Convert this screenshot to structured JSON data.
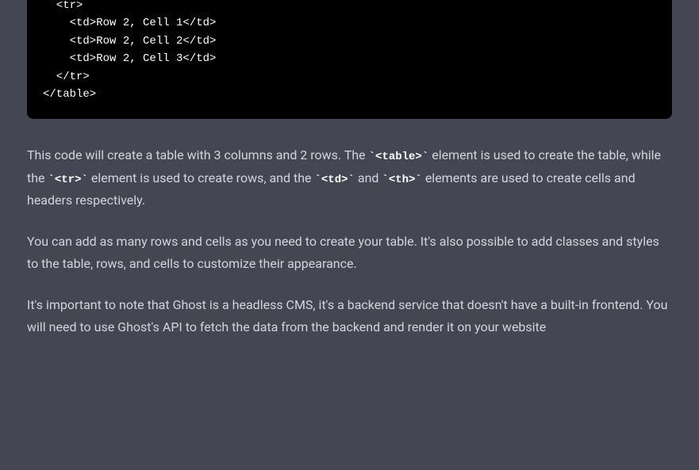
{
  "code": {
    "lines": [
      "  <tr>",
      "    <td>Row 2, Cell 1</td>",
      "    <td>Row 2, Cell 2</td>",
      "    <td>Row 2, Cell 3</td>",
      "  </tr>",
      "</table>"
    ]
  },
  "paragraphs": {
    "p1": {
      "part1": "This code will create a table with 3 columns and 2 rows. The ",
      "code1": "`<table>`",
      "part2": " element is used to create the table, while the ",
      "code2": "`<tr>`",
      "part3": " element is used to create rows, and the ",
      "code3": "`<td>`",
      "part4": " and ",
      "code4": "`<th>`",
      "part5": " elements are used to create cells and headers respectively."
    },
    "p2": "You can add as many rows and cells as you need to create your table. It's also possible to add classes and styles to the table, rows, and cells to customize their appearance.",
    "p3": "It's important to note that Ghost is a headless CMS, it's a backend service that doesn't have a built-in frontend. You will need to use Ghost's API to fetch the data from the backend and render it on your website"
  }
}
